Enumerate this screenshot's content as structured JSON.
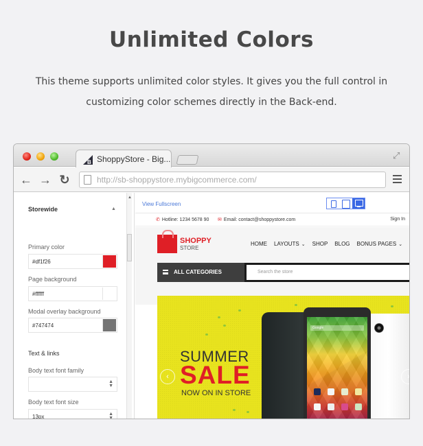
{
  "hero": {
    "title": "Unlimited Colors",
    "description": "This theme supports unlimited color styles. It gives you the full control in customizing color schemes directly in the Back-end."
  },
  "browser": {
    "tab_title": "ShoppyStore - Big...",
    "url": "http://sb-shoppystore.mybigcommerce.com/",
    "icons": {
      "back": "←",
      "forward": "→",
      "reload": "↻",
      "expand": "⤢"
    }
  },
  "sidebar": {
    "section_title": "Storewide",
    "fields": [
      {
        "label": "Primary color",
        "value": "#df1f26",
        "swatch": "#df1f26"
      },
      {
        "label": "Page background",
        "value": "#ffffff",
        "swatch": "#ffffff"
      },
      {
        "label": "Modal overlay background",
        "value": "#747474",
        "swatch": "#747474"
      }
    ],
    "subsection_title": "Text & links",
    "selects": [
      {
        "label": "Body text font family",
        "value": ""
      },
      {
        "label": "Body text font size",
        "value": "13px"
      }
    ]
  },
  "preview": {
    "view_fullscreen": "View Fullscreen",
    "devices": [
      "mobile",
      "tablet",
      "desktop"
    ],
    "active_device": "desktop",
    "accent_color": "#3a68e4"
  },
  "store": {
    "hotline": "Hotline: 1234 5678 90",
    "email": "Email: contact@shoppystore.com",
    "sign_in": "Sign In",
    "logo_name": "SHOPPY",
    "logo_sub": "STORE",
    "nav": [
      {
        "label": "HOME",
        "dropdown": false
      },
      {
        "label": "LAYOUTS",
        "dropdown": true
      },
      {
        "label": "SHOP",
        "dropdown": false
      },
      {
        "label": "BLOG",
        "dropdown": false
      },
      {
        "label": "BONUS PAGES",
        "dropdown": true
      }
    ],
    "all_categories": "ALL CATEGORIES",
    "search_placeholder": "Search the store",
    "banner": {
      "line1": "SUMMER",
      "line2": "SALE",
      "line3": "NOW ON IN STORE",
      "search_text": "Google",
      "prev": "‹",
      "next": "›"
    },
    "brand_color": "#df1f26"
  }
}
